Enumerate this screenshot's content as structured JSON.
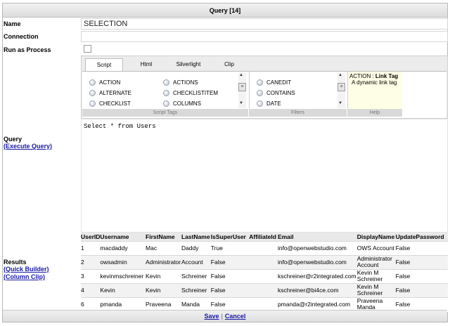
{
  "window": {
    "title": "Query [14]"
  },
  "form": {
    "name_label": "Name",
    "name_value": "SELECTION",
    "connection_label": "Connection",
    "connection_value": "",
    "run_as_process_label": "Run as Process",
    "run_as_process_checked": false,
    "query_label": "Query",
    "execute_query_link": "(Execute Query)",
    "results_label": "Results",
    "quick_builder_link": "(Quick Builder)",
    "column_clip_link": "(Column Clip)"
  },
  "script_panel": {
    "tabs": [
      {
        "label": "Script",
        "active": true
      },
      {
        "label": "Html",
        "active": false
      },
      {
        "label": "Silverlight",
        "active": false
      },
      {
        "label": "Clip",
        "active": false
      }
    ],
    "script_tags": [
      "ACTION",
      "ALTERNATE",
      "CHECKLIST",
      "ACTIONS",
      "CHECKLISTITEM",
      "COLUMNS"
    ],
    "filters": [
      "CANEDIT",
      "CONTAINS",
      "DATE"
    ],
    "help": {
      "title_prefix": "ACTION : ",
      "title_bold": "Link Tag",
      "description": "A dynamic link tag"
    },
    "footers": {
      "script_tags": "Script Tags",
      "filters": "Filters",
      "help": "Help"
    }
  },
  "query_text": "Select * from Users",
  "results": {
    "columns": [
      "UserID",
      "Username",
      "FirstName",
      "LastName",
      "IsSuperUser",
      "AffiliateId",
      "Email",
      "DisplayName",
      "UpdatePassword"
    ],
    "rows": [
      [
        "1",
        "macdaddy",
        "Mac",
        "Daddy",
        "True",
        "",
        "info@openwebstudio.com",
        "OWS Account",
        "False"
      ],
      [
        "2",
        "owsadmin",
        "Administrator",
        "Account",
        "False",
        "",
        "info@openwebstudio.com",
        "Administrator Account",
        "False"
      ],
      [
        "3",
        "kevinmschreiner",
        "Kevin",
        "Schreiner",
        "False",
        "",
        "kschreiner@r2integrated.com",
        "Kevin M Schreiner",
        "False"
      ],
      [
        "4",
        "Kevin",
        "Kevin",
        "Schreiner",
        "False",
        "",
        "kschreiner@bi4ce.com",
        "Kevin M Schreiner",
        "False"
      ],
      [
        "6",
        "pmanda",
        "Praveena",
        "Manda",
        "False",
        "",
        "pmanda@r2integrated.com",
        "Praveena Manda",
        "False"
      ]
    ]
  },
  "actions": {
    "save": "Save",
    "separator": "|",
    "cancel": "Cancel"
  }
}
